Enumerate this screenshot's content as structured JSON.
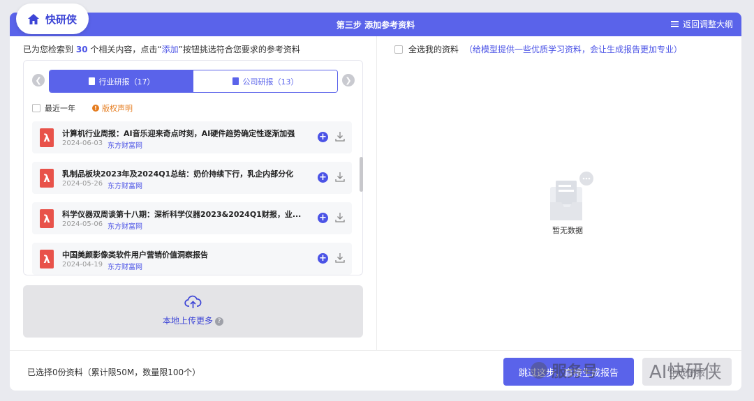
{
  "header": {
    "logo_text": "快研侠",
    "step_title": "第三步 添加参考资料",
    "back_label": "返回调整大纲"
  },
  "left": {
    "summary_prefix": "已为您检索到",
    "summary_count": "30",
    "summary_mid": "个相关内容，点击“",
    "summary_add": "添加",
    "summary_suffix": "”按钮挑选符合您要求的参考资料",
    "tabs": [
      {
        "label": "行业研报（17）",
        "active": true
      },
      {
        "label": "公司研报（13）",
        "active": false
      }
    ],
    "filter_recent": "最近一年",
    "copyright": "版权声明",
    "items": [
      {
        "title": "计算机行业周报：AI音乐迎来奇点时刻，AI硬件趋势确定性逐渐加强",
        "date": "2024-06-03",
        "source": "东方财富网"
      },
      {
        "title": "乳制品板块2023年及2024Q1总结：奶价持续下行，乳企内部分化",
        "date": "2024-05-26",
        "source": "东方财富网"
      },
      {
        "title": "科学仪器双周谈第十八期：深析科学仪器2023&2024Q1财报，业...",
        "date": "2024-05-06",
        "source": "东方财富网"
      },
      {
        "title": "中国美颜影像类软件用户营销价值洞察报告",
        "date": "2024-04-19",
        "source": "东方财富网"
      }
    ],
    "upload_label": "本地上传更多"
  },
  "right": {
    "select_all": "全选我的资料",
    "select_hint": "（给模型提供一些优质学习资料，会让生成报告更加专业）",
    "empty_label": "暂无数据"
  },
  "footer": {
    "chosen_text": "已选择0份资料（累计限50M，数量限100个）",
    "skip_button": "跳过这步，直接生成报告",
    "next_button": "生成研报"
  },
  "watermark": {
    "left": "服务号",
    "right": "AI快研侠"
  },
  "colors": {
    "accent": "#5a63ea",
    "link": "#4b53e6",
    "warning": "#e57c1f",
    "pdf": "#e8524a"
  }
}
